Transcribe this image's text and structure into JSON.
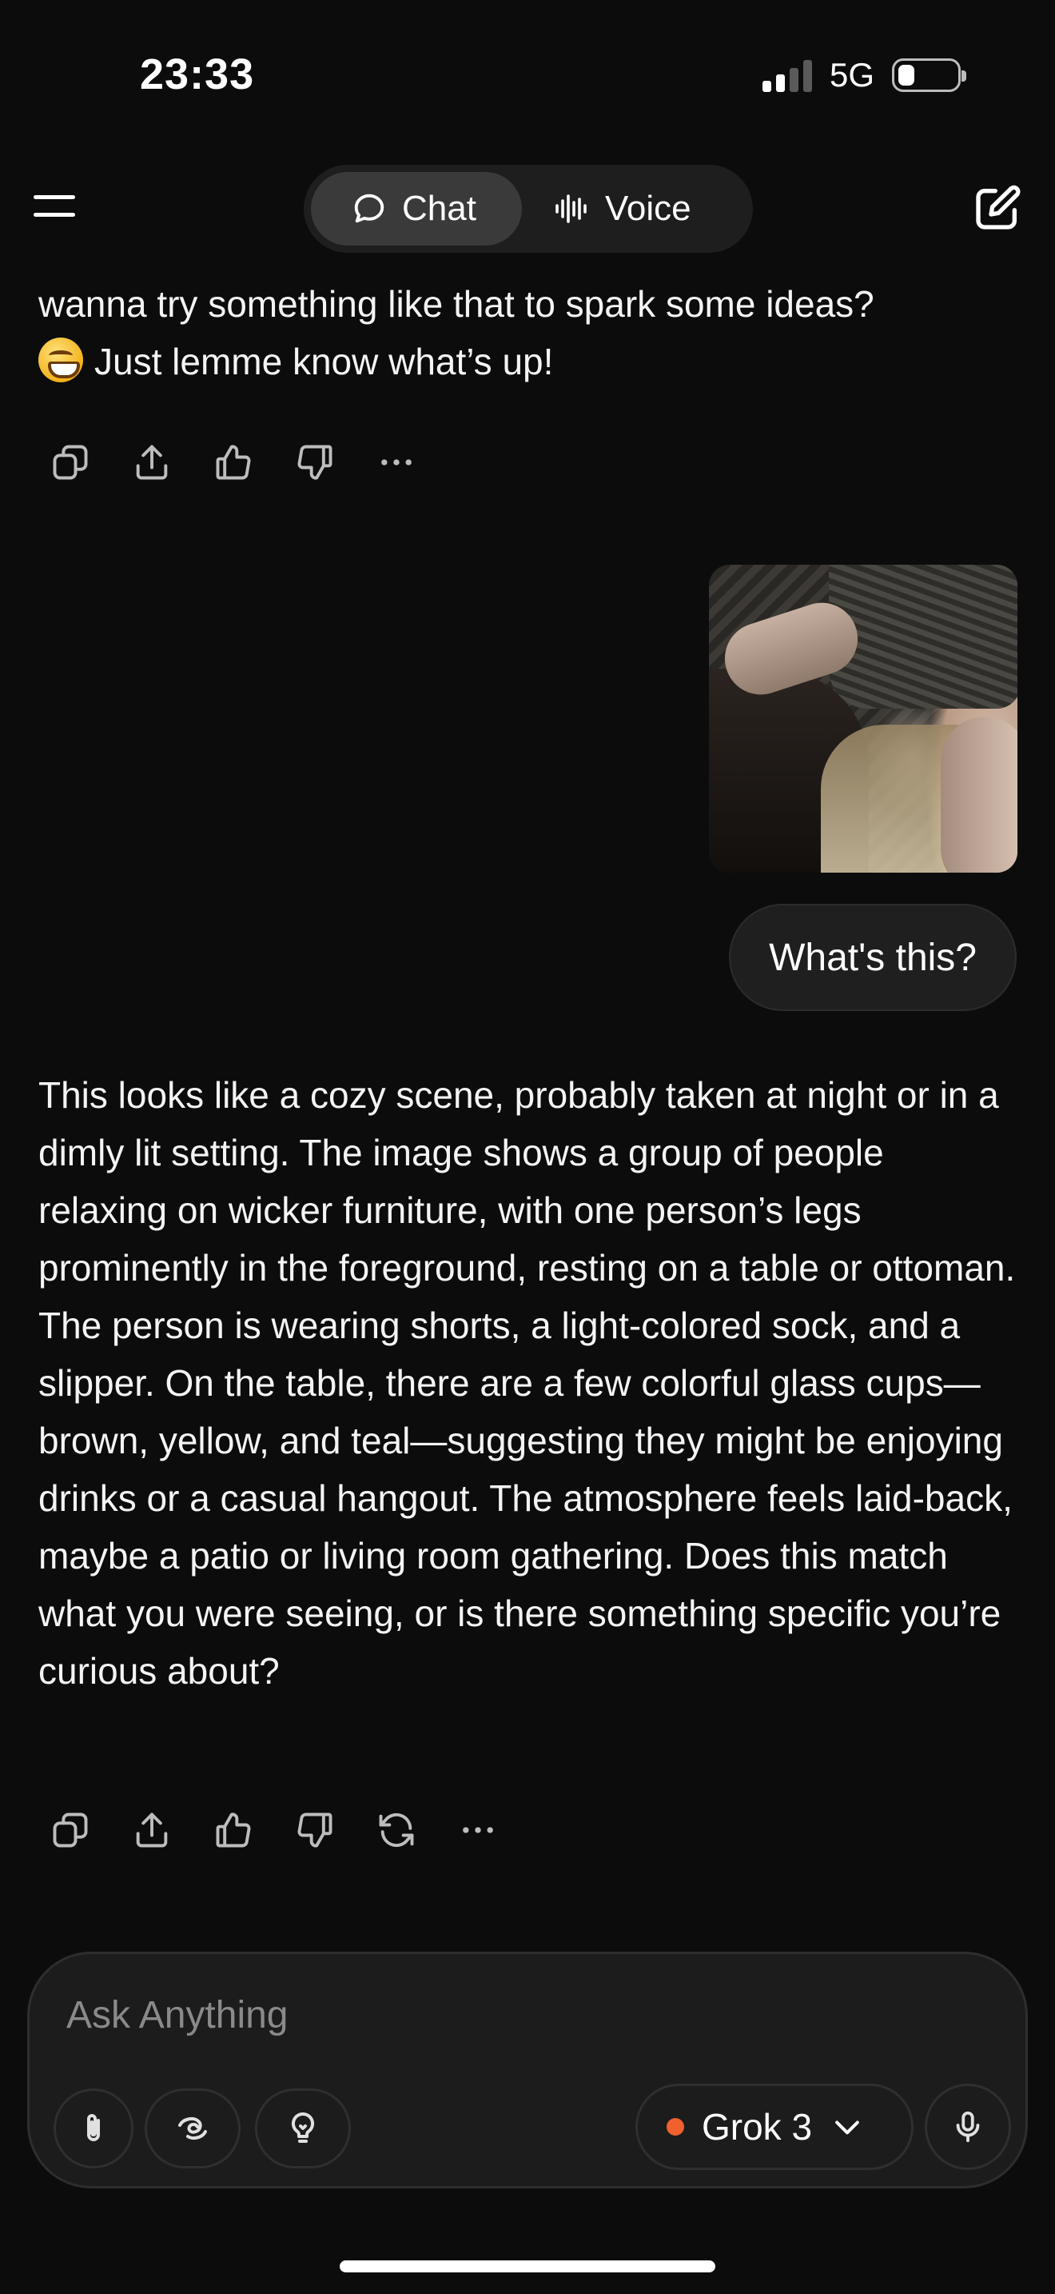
{
  "status_bar": {
    "time": "23:33",
    "network": "5G"
  },
  "header": {
    "mode_tabs": [
      {
        "label": "Chat",
        "icon": "chat-bubble-icon",
        "active": true
      },
      {
        "label": "Voice",
        "icon": "waveform-icon",
        "active": false
      }
    ]
  },
  "conversation": {
    "previous_reply_tail": {
      "line1": "wanna try something like that to spark some ideas?",
      "line2": "Just lemme know what’s up!",
      "emoji": "😄"
    },
    "user_message": {
      "text": "What's this?"
    },
    "assistant_reply": {
      "text": "This looks like a cozy scene, probably taken at night or in a dimly lit setting. The image shows a group of people relaxing on wicker furniture, with one person’s legs prominently in the foreground, resting on a table or ottoman. The person is wearing shorts, a light-colored sock, and a slipper. On the table, there are a few colorful glass cups—brown, yellow, and teal—suggesting they might be enjoying drinks or a casual hangout. The atmosphere feels laid-back, maybe a patio or living room gathering. Does this match what you were seeing, or is there something specific you’re curious about?"
    }
  },
  "composer": {
    "placeholder": "Ask Anything",
    "model_name": "Grok 3",
    "model_dot_color": "#f0612d"
  },
  "colors": {
    "background": "#0c0c0c",
    "bubble": "#1f1f1f",
    "text": "#f4f4f4",
    "muted": "#8a8a8a"
  }
}
